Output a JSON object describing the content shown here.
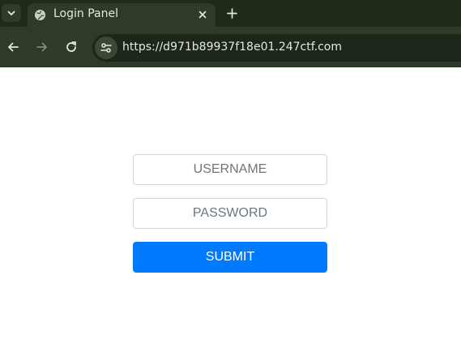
{
  "browser": {
    "tab": {
      "title": "Login Panel",
      "favicon": "globe-icon"
    },
    "toolbar": {
      "url": "https://d971b89937f18e01.247ctf.com"
    },
    "icons": {
      "tab_search": "chevron-down-icon",
      "tab_close": "close-icon",
      "new_tab": "plus-icon",
      "back": "arrow-left-icon",
      "forward": "arrow-right-icon",
      "reload": "reload-icon",
      "site_info": "tune-icon"
    }
  },
  "login_form": {
    "username_placeholder": "USERNAME",
    "password_placeholder": "PASSWORD",
    "submit_label": "SUBMIT"
  },
  "colors": {
    "chrome_dark": "#1e2a1a",
    "chrome": "#2e3b29",
    "submit_bg": "#007bff",
    "submit_text": "#ffffff"
  }
}
